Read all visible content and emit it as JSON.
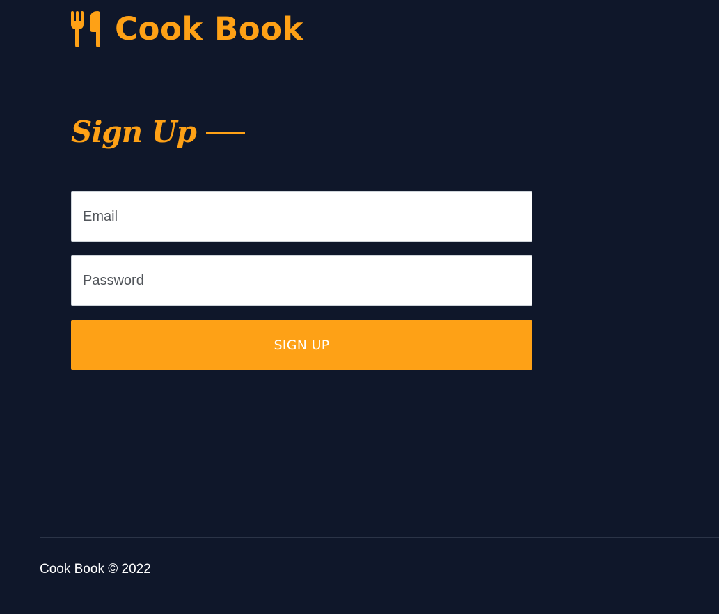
{
  "header": {
    "brand_name": "Cook Book",
    "brand_icon": "utensils-icon"
  },
  "signup": {
    "title": "Sign Up",
    "email_placeholder": "Email",
    "password_placeholder": "Password",
    "submit_label": "SIGN UP"
  },
  "footer": {
    "copyright": "Cook Book © 2022"
  },
  "colors": {
    "background": "#0f172a",
    "accent": "#fea116",
    "input_background": "#ffffff",
    "text": "#ffffff"
  }
}
